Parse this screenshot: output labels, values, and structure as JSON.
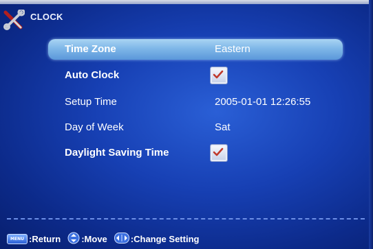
{
  "header": {
    "title": "CLOCK",
    "icon": "tools-icon"
  },
  "settings": [
    {
      "label": "Time Zone",
      "value": "Eastern",
      "selected": true
    },
    {
      "label": "Auto Clock",
      "checked": true
    },
    {
      "label": "Setup Time",
      "value": "2005-01-01 12:26:55"
    },
    {
      "label": "Day of Week",
      "value": "Sat"
    },
    {
      "label": "Daylight Saving Time",
      "checked": true
    }
  ],
  "footer": {
    "menu_key": "MENU",
    "return_label": ":Return",
    "move_label": ":Move",
    "change_label": ":Change Setting"
  },
  "colors": {
    "background": "#1740b4",
    "selected_row": "#7fb7e8",
    "check_mark": "#c0392b"
  }
}
